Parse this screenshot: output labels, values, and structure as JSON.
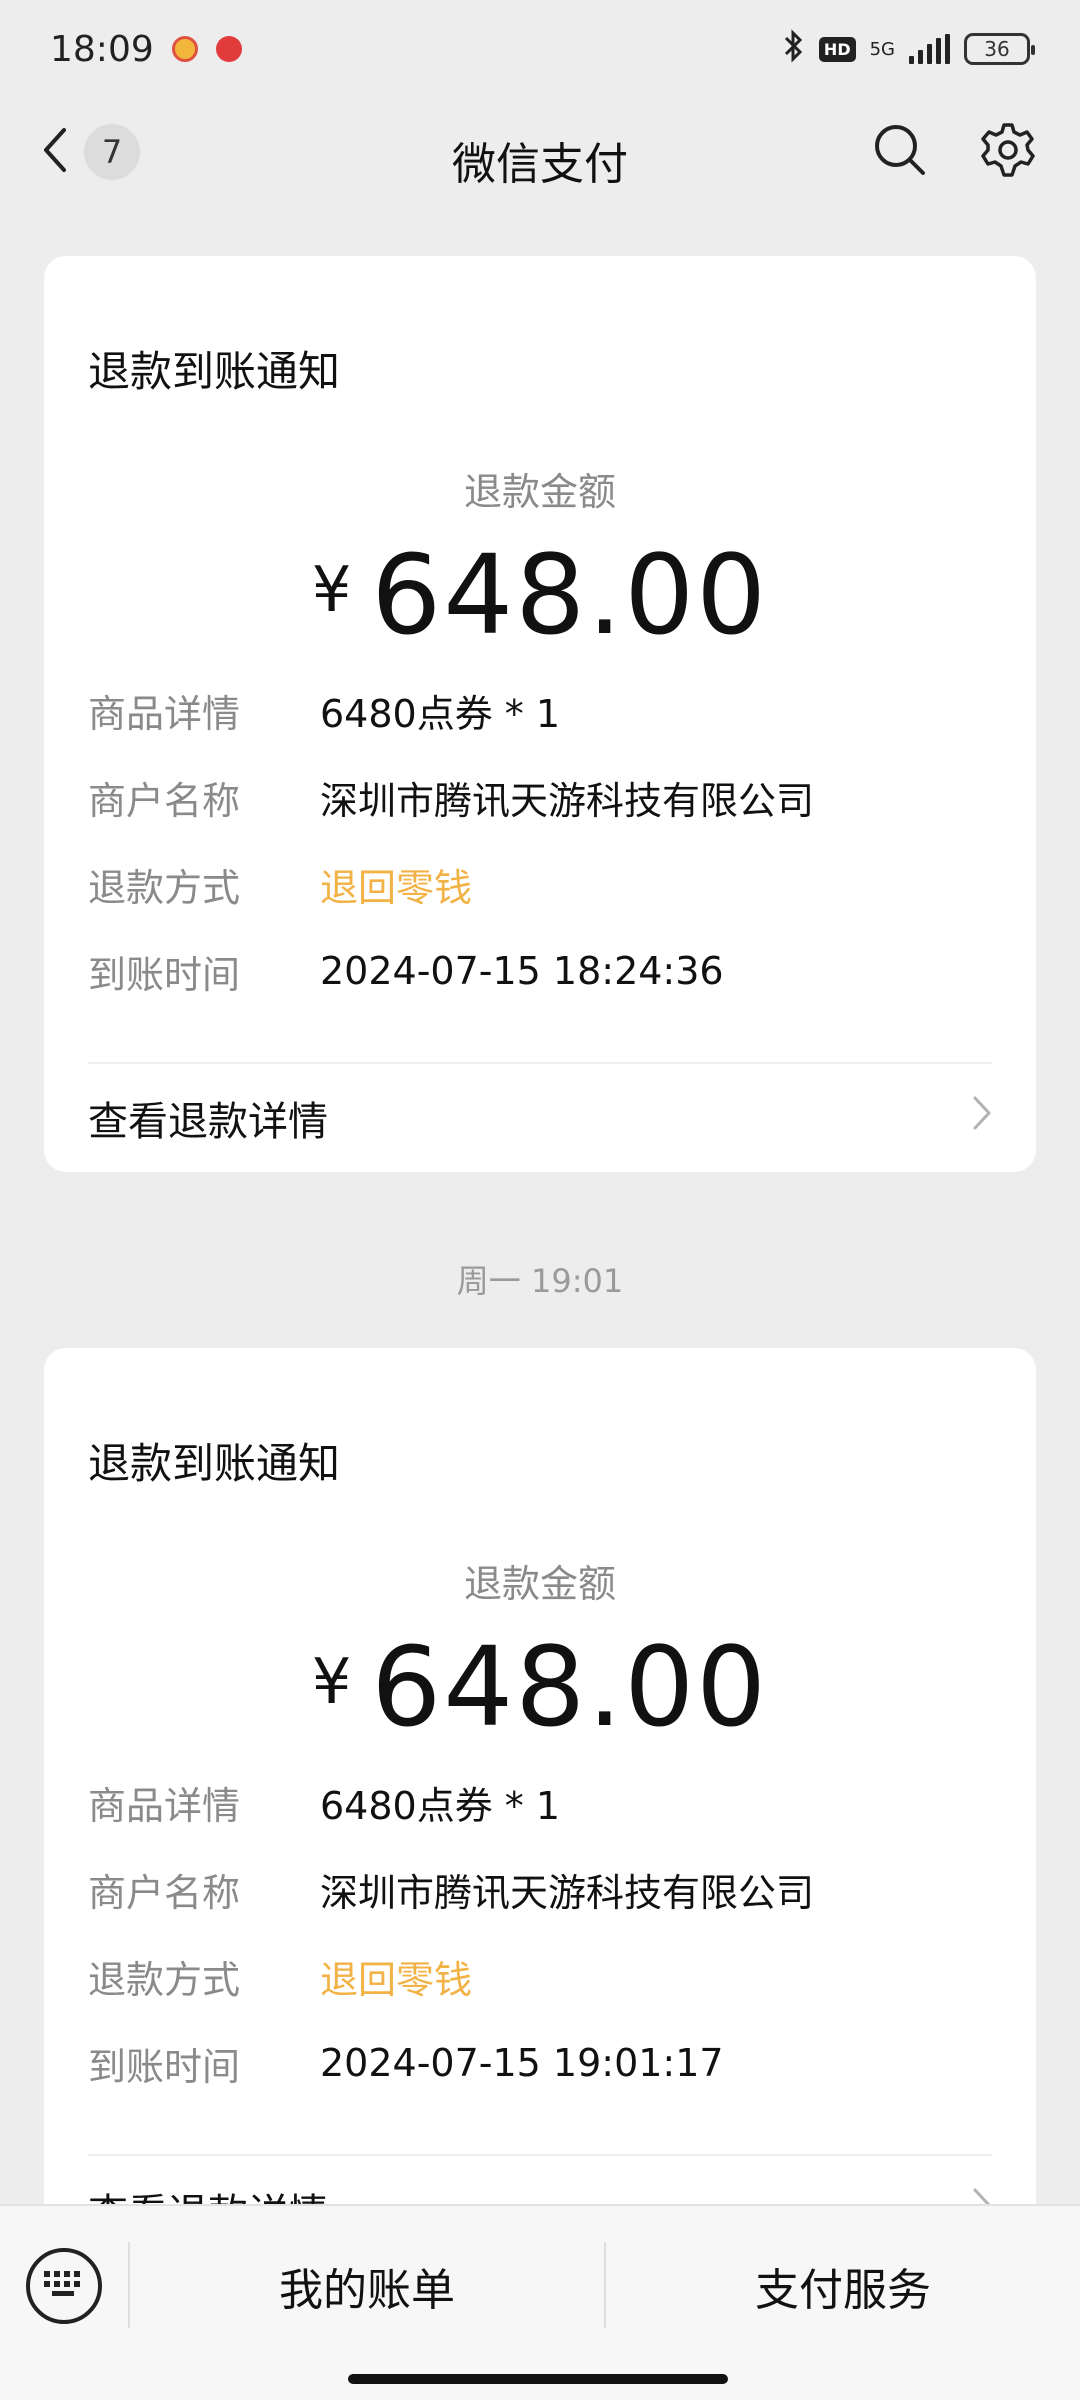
{
  "status_bar": {
    "time": "18:09",
    "network": "5G",
    "hd": "HD",
    "battery": "36"
  },
  "nav": {
    "back_count": "7",
    "title": "微信支付"
  },
  "cards": [
    {
      "title": "退款到账通知",
      "amount_label": "退款金额",
      "currency": "¥",
      "amount": "648.00",
      "rows": [
        {
          "key": "商品详情",
          "value": "6480点券 * 1"
        },
        {
          "key": "商户名称",
          "value": "深圳市腾讯天游科技有限公司"
        },
        {
          "key": "退款方式",
          "value": "退回零钱"
        },
        {
          "key": "到账时间",
          "value": "2024-07-15 18:24:36"
        }
      ],
      "link": "查看退款详情"
    },
    {
      "title": "退款到账通知",
      "amount_label": "退款金额",
      "currency": "¥",
      "amount": "648.00",
      "rows": [
        {
          "key": "商品详情",
          "value": "6480点券 * 1"
        },
        {
          "key": "商户名称",
          "value": "深圳市腾讯天游科技有限公司"
        },
        {
          "key": "退款方式",
          "value": "退回零钱"
        },
        {
          "key": "到账时间",
          "value": "2024-07-15 19:01:17"
        }
      ],
      "link": "查看退款详情"
    }
  ],
  "timestamp_divider": "周一 19:01",
  "bottom_bar": {
    "left_menu": "我的账单",
    "right_menu": "支付服务"
  },
  "colors": {
    "background": "#ededed",
    "refund_method": "#f2b245"
  }
}
